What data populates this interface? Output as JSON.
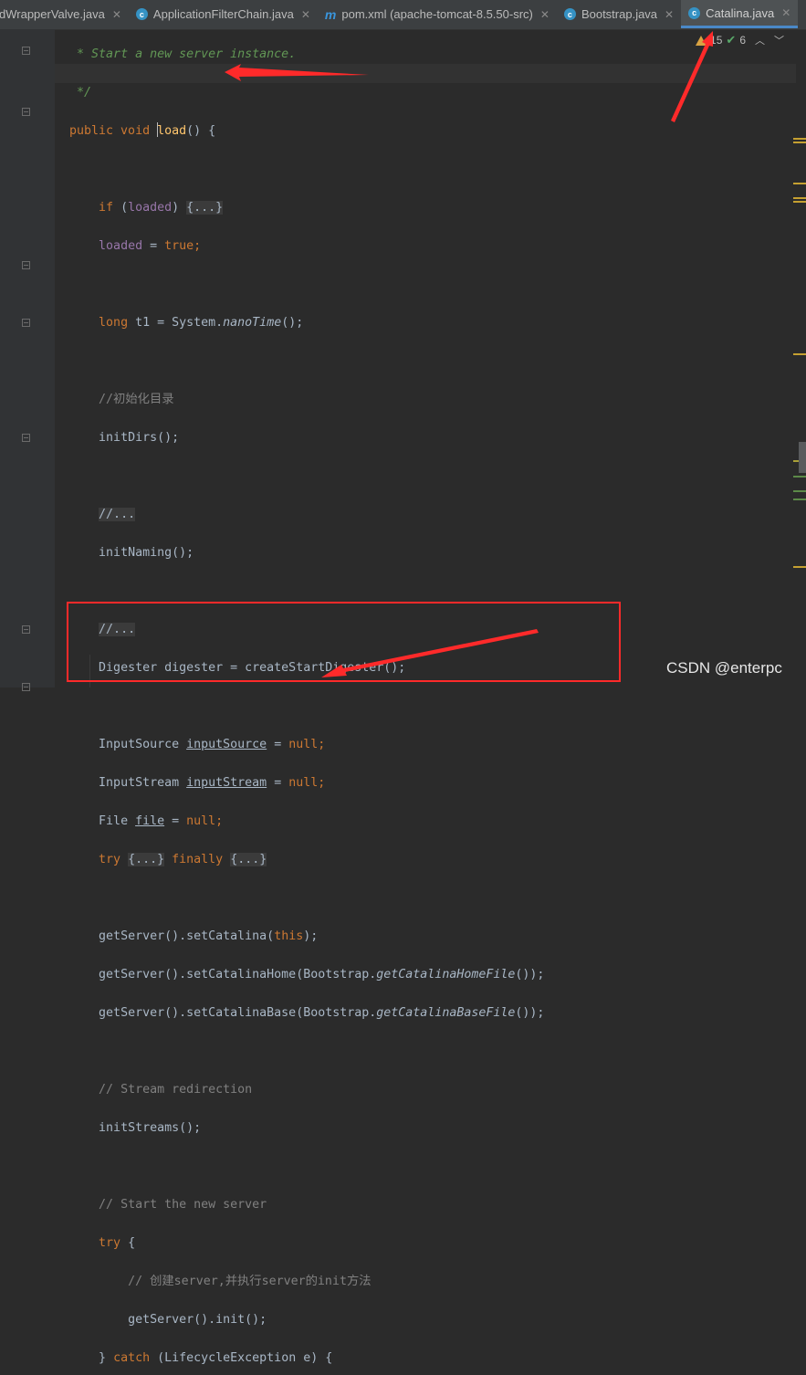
{
  "tabs": [
    {
      "icon": "class-icon",
      "label": "dWrapperValve.java",
      "active": false
    },
    {
      "icon": "class-icon",
      "label": "ApplicationFilterChain.java",
      "active": false
    },
    {
      "icon": "maven-icon",
      "label": "pom.xml (apache-tomcat-8.5.50-src)",
      "active": false
    },
    {
      "icon": "class-icon",
      "label": "Bootstrap.java",
      "active": false
    },
    {
      "icon": "class-icon",
      "label": "Catalina.java",
      "active": true
    }
  ],
  "inspector": {
    "warnings": "15",
    "ok": "6"
  },
  "code": {
    "l1": "* Start a new server instance.",
    "l2": "*/",
    "l3_kw": "public void ",
    "l3_fn": "load",
    "l3_rest": "() {",
    "l5_kw": "if",
    "l5_paren_open": " (",
    "l5_field": "loaded",
    "l5_paren_close": ") ",
    "l5_fold": "{...}",
    "l6_field": "loaded",
    "l6_eq": " = ",
    "l6_val": "true",
    "l6_semi": ";",
    "l8_kw": "long",
    "l8_a": " t1 = System.",
    "l8_it": "nanoTime",
    "l8_b": "();",
    "l10": "//初始化目录",
    "l11": "initDirs();",
    "l13": "//...",
    "l14": "initNaming();",
    "l16": "//...",
    "l17": "Digester digester = createStartDigester();",
    "l19_a": "InputSource ",
    "l19_u": "inputSource",
    "l19_b": " = ",
    "l19_null": "null",
    "l19_c": ";",
    "l20_a": "InputStream ",
    "l20_u": "inputStream",
    "l20_b": " = ",
    "l20_null": "null",
    "l20_c": ";",
    "l21_a": "File ",
    "l21_u": "file",
    "l21_b": " = ",
    "l21_null": "null",
    "l21_c": ";",
    "l22_try": "try",
    "l22_f1": "{...}",
    "l22_fin": "finally",
    "l22_f2": "{...}",
    "l24_a": "getServer().setCatalina(",
    "l24_this": "this",
    "l24_b": ");",
    "l25_a": "getServer().setCatalinaHome(Bootstrap.",
    "l25_it": "getCatalinaHomeFile",
    "l25_b": "());",
    "l26_a": "getServer().setCatalinaBase(Bootstrap.",
    "l26_it": "getCatalinaBaseFile",
    "l26_b": "());",
    "l28": "// Stream redirection",
    "l29": "initStreams();",
    "l31": "// Start the new server",
    "l32_try": "try",
    "l32_b": " {",
    "l33": "// 创建server,并执行server的init方法",
    "l34": "getServer().init();",
    "l35_a": "} ",
    "l35_kw": "catch",
    "l35_b": " (LifecycleException e) {"
  },
  "watermark": "CSDN @enterpc",
  "colors": {
    "arrow": "#ff2a2a",
    "accent": "#4a88c7"
  }
}
